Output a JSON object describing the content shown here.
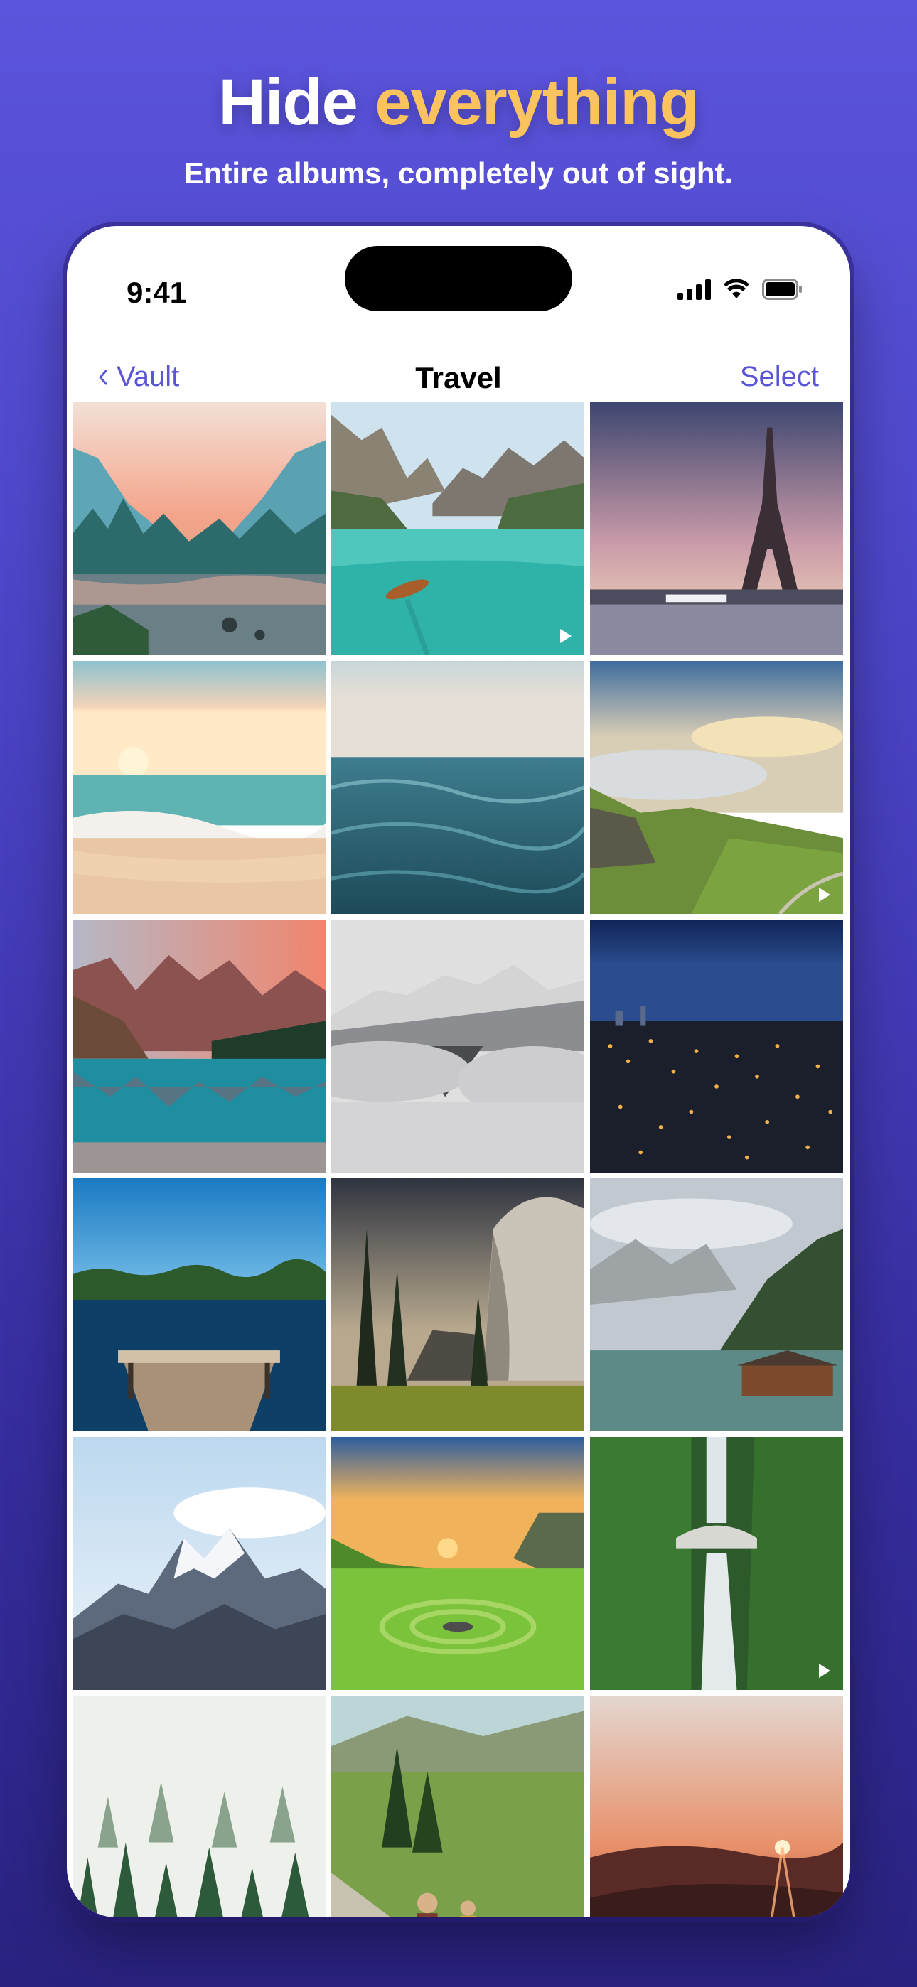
{
  "headline": {
    "part1": "Hide",
    "part2": "everything"
  },
  "subheadline": "Entire albums, completely out of sight.",
  "status_bar": {
    "time": "9:41",
    "icons": [
      "signal-icon",
      "wifi-icon",
      "battery-icon"
    ]
  },
  "nav": {
    "back_label": "Vault",
    "back_icon": "chevron-left-icon",
    "title": "Travel",
    "select_label": "Select"
  },
  "colors": {
    "accent": "#5a55d6",
    "headline_accent": "#fbc35e",
    "background_top": "#5b54dc",
    "background_bottom": "#2a2280"
  },
  "photos": [
    {
      "name": "photo-valley-river",
      "video": false
    },
    {
      "name": "photo-lake-boat",
      "video": true
    },
    {
      "name": "photo-eiffel-tower",
      "video": false
    },
    {
      "name": "photo-beach-sunset",
      "video": false
    },
    {
      "name": "photo-ocean-water",
      "video": false
    },
    {
      "name": "photo-cliff-clouds",
      "video": true
    },
    {
      "name": "photo-mountain-lake-reflection",
      "video": false
    },
    {
      "name": "photo-misty-mountain",
      "video": false
    },
    {
      "name": "photo-city-lights",
      "video": false
    },
    {
      "name": "photo-lake-dock",
      "video": false
    },
    {
      "name": "photo-granite-cliff-forest",
      "video": false
    },
    {
      "name": "photo-lakeside-cabin",
      "video": false
    },
    {
      "name": "photo-snowy-peak",
      "video": false
    },
    {
      "name": "photo-green-valley-sunset",
      "video": false
    },
    {
      "name": "photo-waterfall-bridge",
      "video": true
    },
    {
      "name": "photo-foggy-forest",
      "video": false
    },
    {
      "name": "photo-hikers-meadow",
      "video": false
    },
    {
      "name": "photo-mountain-sunset",
      "video": false
    }
  ]
}
